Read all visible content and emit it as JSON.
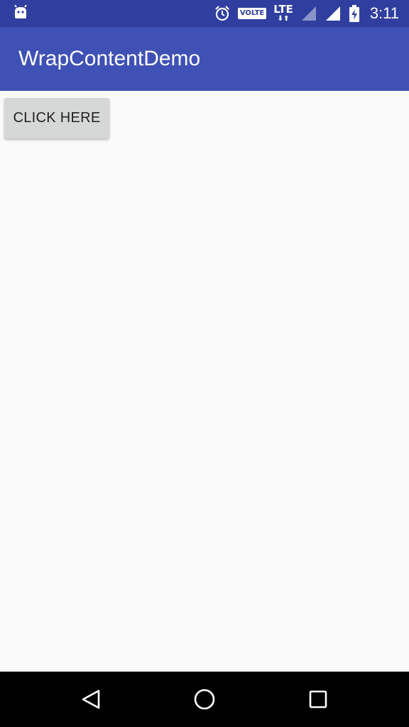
{
  "status_bar": {
    "time": "3:11",
    "volte_label": "VOLTE",
    "network_label": "LTE",
    "network_arrows": "⬇⬆",
    "left_icons": [
      "android-notification-icon"
    ],
    "right_icons": [
      "alarm-icon",
      "volte-icon",
      "lte-icon",
      "signal-icon",
      "wifi-signal-icon",
      "battery-charging-icon"
    ],
    "color": "#303f9f"
  },
  "app_bar": {
    "title": "WrapContentDemo",
    "color": "#3f51b5"
  },
  "content": {
    "button_label": "CLICK HERE",
    "button_color": "#d6d7d7",
    "background": "#fafafa"
  },
  "nav_bar": {
    "buttons": [
      "back-icon",
      "home-icon",
      "recents-icon"
    ],
    "color": "#000000"
  }
}
